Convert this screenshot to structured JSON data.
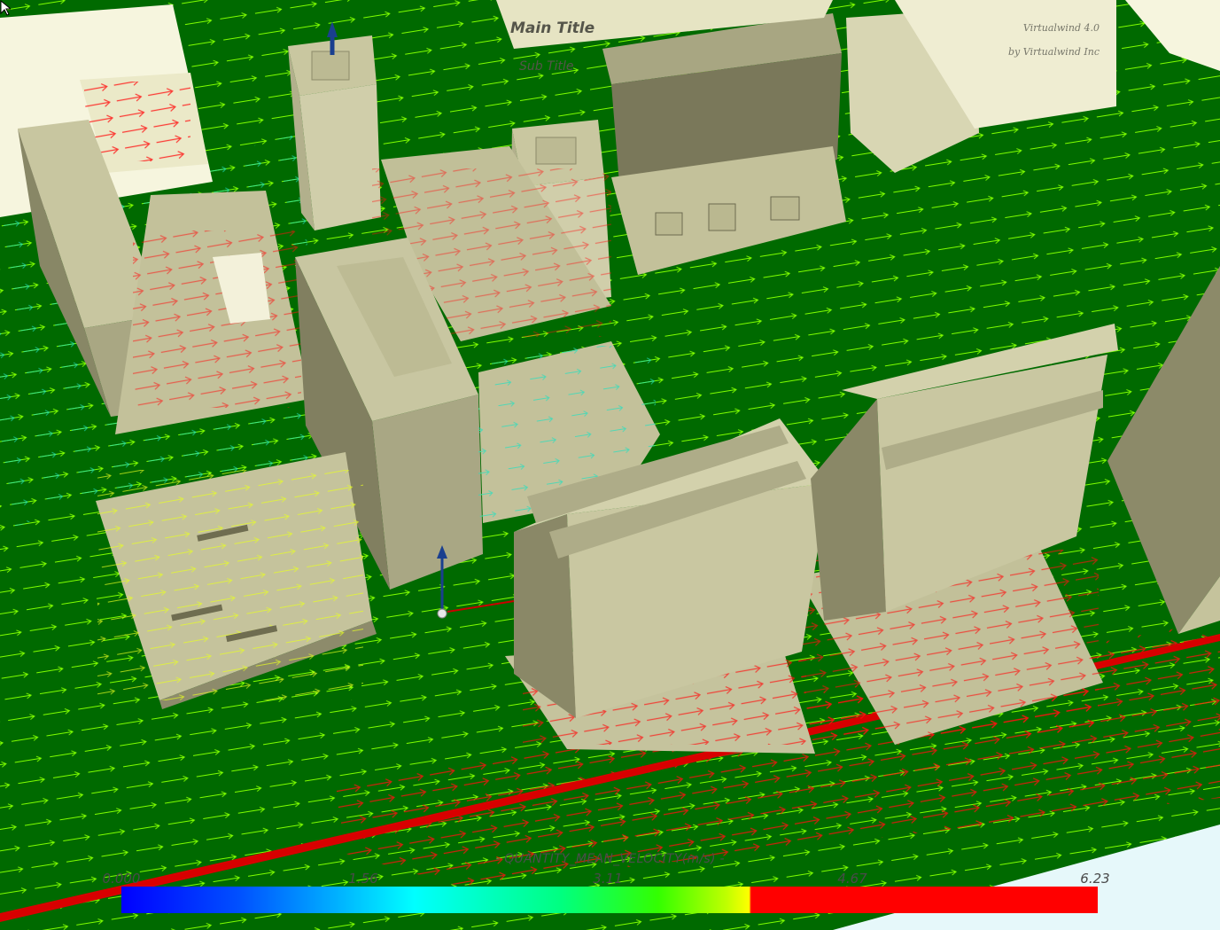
{
  "titles": {
    "main": "Main Title",
    "sub": "Sub Title",
    "brand_line1": "Virtualwind 4.0",
    "brand_line2": "by Virtualwind Inc"
  },
  "legend": {
    "quantity_label": "- QUANTITY_MEAN_VELOCITY(m/s) -",
    "ticks": [
      "0.000",
      "1.56",
      "3.11",
      "4.67",
      "6.23"
    ],
    "min": 0.0,
    "max": 6.23
  },
  "colors": {
    "ground": "#006a00",
    "building_lit": "#cbc9a0",
    "building_top": "#bdbb92",
    "building_shade": "#7a785a",
    "vector_low": "#00ffff",
    "vector_mid": "#66ff00",
    "vector_high": "#ff0000",
    "probe": "#1a3f8f"
  },
  "icons": {
    "probe": "arrow-up-icon",
    "cursor": "mouse-pointer-icon"
  }
}
